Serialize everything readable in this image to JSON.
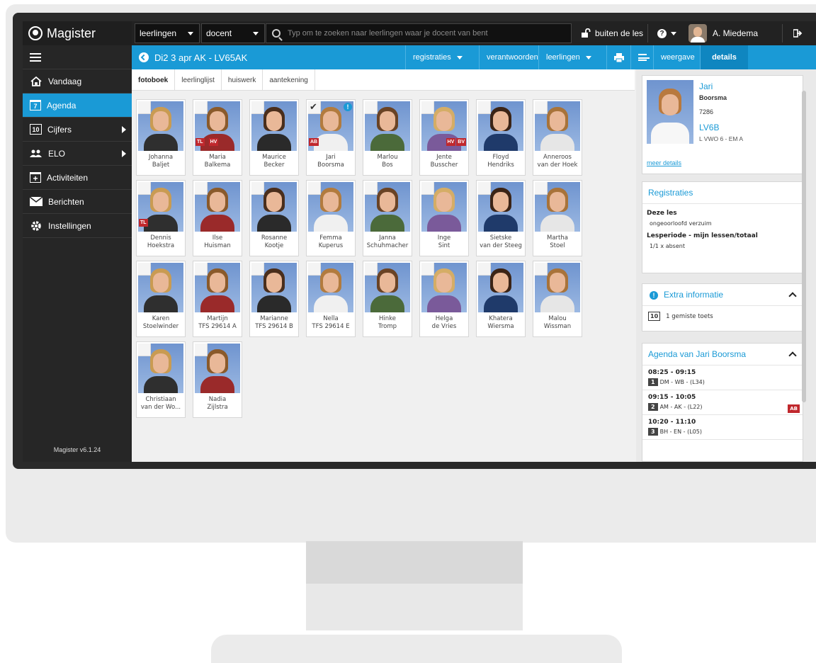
{
  "topbar": {
    "app_name": "Magister",
    "select1": "leerlingen",
    "select2": "docent",
    "search_placeholder": "Typ om te zoeken naar leerlingen waar je docent van bent",
    "lock_label": "buiten de les",
    "user_name": "A. Miedema"
  },
  "sidebar": {
    "items": [
      {
        "label": "Vandaag",
        "icon": "home-icon"
      },
      {
        "label": "Agenda",
        "icon": "calendar-icon",
        "badge": "7"
      },
      {
        "label": "Cijfers",
        "icon": "grades-icon",
        "badge": "10"
      },
      {
        "label": "ELO",
        "icon": "people-icon"
      },
      {
        "label": "Activiteiten",
        "icon": "calendar-plus-icon"
      },
      {
        "label": "Berichten",
        "icon": "envelope-icon"
      },
      {
        "label": "Instellingen",
        "icon": "gear-icon"
      }
    ],
    "version": "Magister v6.1.24"
  },
  "header": {
    "title": "Di2 3 apr AK - LV65AK",
    "buttons": [
      "registraties",
      "verantwoorden",
      "leerlingen"
    ],
    "right_tabs": [
      "weergave",
      "details"
    ]
  },
  "tabs": [
    "fotoboek",
    "leerlinglijst",
    "huiswerk",
    "aantekening"
  ],
  "students": [
    {
      "first": "Johanna",
      "last": "Baljet"
    },
    {
      "first": "Maria",
      "last": "Balkema",
      "tags": [
        "TL",
        "HV"
      ]
    },
    {
      "first": "Maurice",
      "last": "Becker"
    },
    {
      "first": "Jari",
      "last": "Boorsma",
      "tags": [
        "AB"
      ]
    },
    {
      "first": "Marlou",
      "last": "Bos"
    },
    {
      "first": "Jente",
      "last": "Busscher",
      "tags": [
        "HV",
        "BV"
      ]
    },
    {
      "first": "Floyd",
      "last": "Hendriks"
    },
    {
      "first": "Anneroos",
      "last": "van der Hoek"
    },
    {
      "first": "Dennis",
      "last": "Hoekstra",
      "tags": [
        "TL"
      ]
    },
    {
      "first": "Ilse",
      "last": "Huisman"
    },
    {
      "first": "Rosanne",
      "last": "Kootje"
    },
    {
      "first": "Femma",
      "last": "Kuperus"
    },
    {
      "first": "Janna",
      "last": "Schuhmacher"
    },
    {
      "first": "Inge",
      "last": "Sint"
    },
    {
      "first": "Sietske",
      "last": "van der Steeg"
    },
    {
      "first": "Martha",
      "last": "Stoel"
    },
    {
      "first": "Karen",
      "last": "Stoelwinder"
    },
    {
      "first": "Martijn",
      "last": "TFS 29614 A"
    },
    {
      "first": "Marianne",
      "last": "TFS 29614 B"
    },
    {
      "first": "Nella",
      "last": "TFS 29614 E"
    },
    {
      "first": "Hinke",
      "last": "Tromp"
    },
    {
      "first": "Helga",
      "last": "de Vries"
    },
    {
      "first": "Khatera",
      "last": "Wiersma"
    },
    {
      "first": "Malou",
      "last": "Wissman"
    },
    {
      "first": "Christiaan",
      "last": "van der Wo..."
    },
    {
      "first": "Nadia",
      "last": "Zijlstra"
    }
  ],
  "details": {
    "first": "Jari",
    "last": "Boorsma",
    "number": "7286",
    "class": "LV6B",
    "program": "L VWO 6 - EM A",
    "more_link": "meer details"
  },
  "registraties": {
    "title": "Registraties",
    "deze_les_heading": "Deze les",
    "deze_les_value": "ongeoorloofd verzuim",
    "lesperiode_heading": "Lesperiode - mijn lessen/totaal",
    "lesperiode_value": "1/1 x absent"
  },
  "extra": {
    "title": "Extra informatie",
    "badge": "10",
    "text": "1 gemiste toets"
  },
  "agenda": {
    "title": "Agenda van Jari Boorsma",
    "items": [
      {
        "time": "08:25 - 09:15",
        "hour": "1",
        "desc": "DM - WB - (L34)"
      },
      {
        "time": "09:15 - 10:05",
        "hour": "2",
        "desc": "AM - AK - (L22)",
        "tag": "AB"
      },
      {
        "time": "10:20 - 11:10",
        "hour": "3",
        "desc": "BH - EN - (L05)"
      }
    ]
  }
}
